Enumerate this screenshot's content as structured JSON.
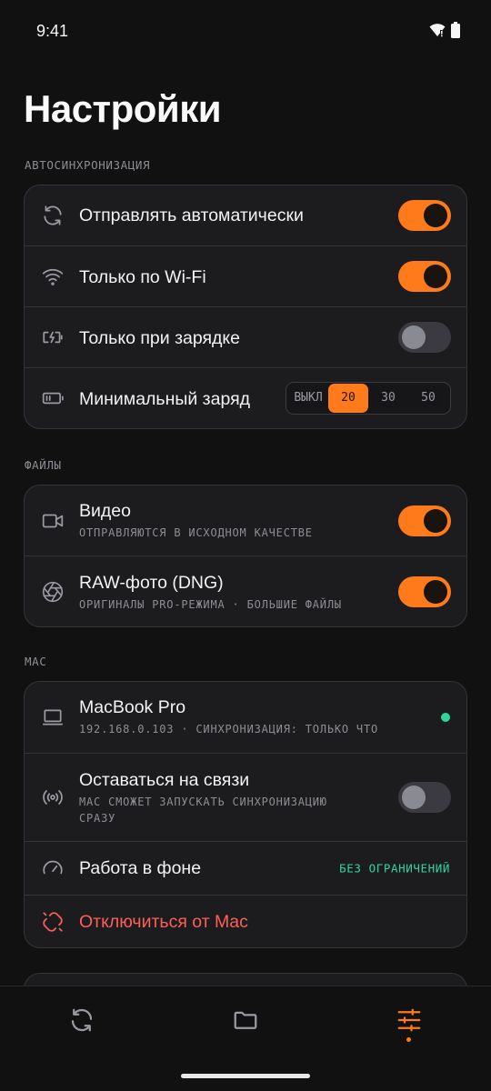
{
  "status": {
    "time": "9:41"
  },
  "page": {
    "title": "Настройки"
  },
  "sections": {
    "autosync": {
      "label": "АВТОСИНХРОНИЗАЦИЯ",
      "auto_send": {
        "title": "Отправлять автоматически",
        "on": true
      },
      "wifi_only": {
        "title": "Только по Wi-Fi",
        "on": true
      },
      "charging_only": {
        "title": "Только при зарядке",
        "on": false
      },
      "min_charge": {
        "title": "Минимальный заряд",
        "options": [
          "ВЫКЛ",
          "20",
          "30",
          "50"
        ],
        "selected": "20"
      }
    },
    "files": {
      "label": "ФАЙЛЫ",
      "video": {
        "title": "Видео",
        "subtitle": "ОТПРАВЛЯЮТСЯ В ИСХОДНОМ КАЧЕСТВЕ",
        "on": true
      },
      "raw": {
        "title": "RAW-фото (DNG)",
        "subtitle": "ОРИГИНАЛЫ PRO-РЕЖИМА · БОЛЬШИЕ ФАЙЛЫ",
        "on": true
      }
    },
    "mac": {
      "label": "MAC",
      "device": {
        "title": "MacBook Pro",
        "subtitle": "192.168.0.103 · СИНХРОНИЗАЦИЯ: ТОЛЬКО ЧТО",
        "connected": true
      },
      "stay_connected": {
        "title": "Оставаться на связи",
        "subtitle_line1": "MAC СМОЖЕТ ЗАПУСКАТЬ СИНХРОНИЗАЦИЮ",
        "subtitle_line2": "СРАЗУ",
        "on": false
      },
      "background": {
        "title": "Работа в фоне",
        "value": "БЕЗ ОГРАНИЧЕНИЙ"
      },
      "disconnect": {
        "title": "Отключиться от Mac"
      }
    }
  },
  "tabs": [
    {
      "icon": "sync-icon",
      "active": false
    },
    {
      "icon": "folder-icon",
      "active": false
    },
    {
      "icon": "sliders-icon",
      "active": true
    }
  ],
  "colors": {
    "accent": "#ff7a1a",
    "success": "#2ed69a",
    "danger": "#ff5f57",
    "background": "#111112",
    "card": "#1c1c1f"
  }
}
